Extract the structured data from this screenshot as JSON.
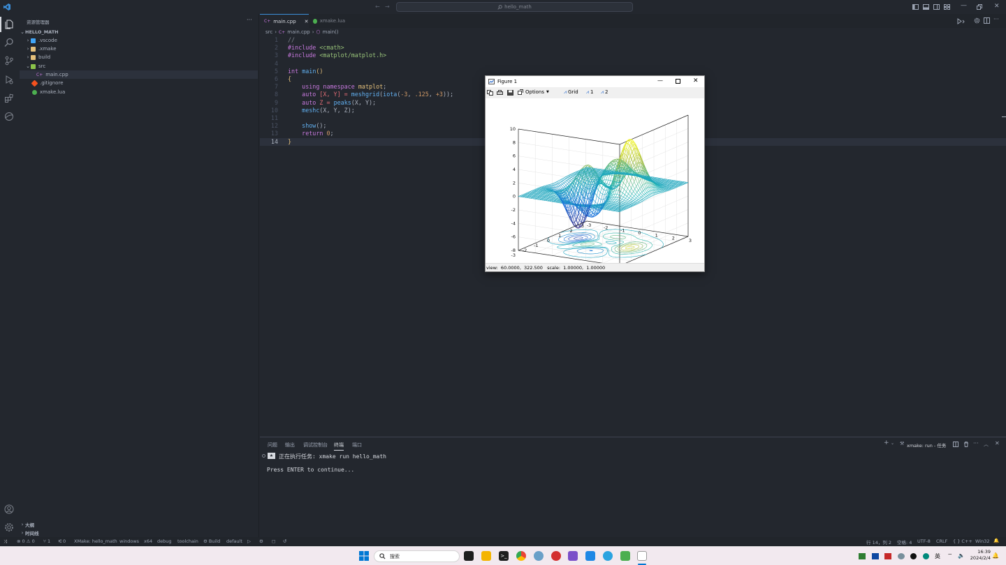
{
  "titlebar": {
    "search_text": "hello_math"
  },
  "sidebar": {
    "title": "资源管理器",
    "more": "···",
    "project": "HELLO_MATH",
    "items": [
      {
        "label": ".vscode",
        "kind": "folder",
        "color": "#42a5f5"
      },
      {
        "label": ".xmake",
        "kind": "folder",
        "color": "#e5c07b"
      },
      {
        "label": "build",
        "kind": "folder",
        "color": "#e5c07b"
      },
      {
        "label": "src",
        "kind": "folder-open",
        "color": "#8bc34a"
      },
      {
        "label": "main.cpp",
        "kind": "file",
        "color": "#c678dd"
      },
      {
        "label": ".gitignore",
        "kind": "file",
        "color": "#f4511e"
      },
      {
        "label": "xmake.lua",
        "kind": "file",
        "color": "#4caf50"
      }
    ],
    "outline": "大纲",
    "timeline": "时间线"
  },
  "tabs": [
    {
      "label": "main.cpp",
      "active": true,
      "close": "✕"
    },
    {
      "label": "xmake.lua",
      "active": false
    }
  ],
  "breadcrumb": {
    "folder": "src",
    "file": "main.cpp",
    "symbol": "main()"
  },
  "code": {
    "lines": [
      "1",
      "2",
      "3",
      "4",
      "5",
      "6",
      "7",
      "8",
      "9",
      "10",
      "11",
      "12",
      "13",
      "14"
    ],
    "l1": "//",
    "l2_kw": "#include",
    "l2_arg": "<cmath>",
    "l3_kw": "#include",
    "l3_arg": "<matplot/matplot.h>",
    "l5_type": "int",
    "l5_fn": "main",
    "l5_paren": "()",
    "l6": "{",
    "l7_kw": "using namespace",
    "l7_ns": "matplot",
    "l7_end": ";",
    "l8_kw": "auto",
    "l8_a": "[X, Y] = ",
    "l8_fn1": "meshgrid",
    "l8_b": "(",
    "l8_fn2": "iota",
    "l8_c": "(",
    "l8_n1": "-3",
    "l8_d": ", ",
    "l8_n2": ".125",
    "l8_e": ", ",
    "l8_n3": "+3",
    "l8_f": "));",
    "l9_kw": "auto",
    "l9_a": "Z = ",
    "l9_fn": "peaks",
    "l9_b": "(X, Y);",
    "l10_fn": "meshc",
    "l10_b": "(X, Y, Z);",
    "l12_fn": "show",
    "l12_b": "();",
    "l13_kw": "return",
    "l13_n": "0",
    "l13_b": ";",
    "l14": "}"
  },
  "panel": {
    "tabs": [
      "问题",
      "输出",
      "调试控制台",
      "终端",
      "端口"
    ],
    "active_tab": "终端",
    "task_label": "xmake: run - 任务",
    "task_line": "正在执行任务: xmake run hello_math",
    "prompt_line": "Press ENTER to continue..."
  },
  "statusbar": {
    "errors": "0",
    "warnings": "0",
    "sync": "1",
    "ports": "0",
    "project": "XMake: hello_math",
    "platform": "windows",
    "arch": "x64",
    "mode": "debug",
    "toolchain": "toolchain",
    "build": "Build",
    "target": "default",
    "position": "行 14，列 2",
    "spaces": "空格: 4",
    "encoding": "UTF-8",
    "eol": "CRLF",
    "language": "C++",
    "os": "Win32"
  },
  "taskbar": {
    "search_placeholder": "搜索",
    "ime": "英",
    "time": "16:39",
    "date": "2024/2/4"
  },
  "figure": {
    "title": "Figure 1",
    "toolbar": {
      "options": "Options",
      "grid": "Grid",
      "one": "1",
      "two": "2"
    },
    "status": "view:  60.0000,  322.500   scale:  1.00000,  1.00000",
    "z_ticks": [
      "10",
      "8",
      "6",
      "4",
      "2",
      "0",
      "-2",
      "-4",
      "-6",
      "-8"
    ],
    "x_ticks": [
      "3",
      "2",
      "1",
      "0",
      "-1",
      "-2",
      "-3"
    ],
    "y_ticks": [
      "-3",
      "-2",
      "-1",
      "0",
      "1",
      "2",
      "3"
    ]
  },
  "chart_data": {
    "type": "surface-mesh-with-contours",
    "function": "peaks",
    "x_range": [
      -3,
      3
    ],
    "y_range": [
      -3,
      3
    ],
    "grid_step": 0.125,
    "zlim": [
      -8,
      10
    ],
    "view": [
      60.0,
      322.5
    ],
    "colormap": "parula",
    "z_ticks": [
      10,
      8,
      6,
      4,
      2,
      0,
      -2,
      -4,
      -6,
      -8
    ],
    "x_ticks": [
      3,
      2,
      1,
      0,
      -1,
      -2,
      -3
    ],
    "y_ticks": [
      -3,
      -2,
      -1,
      0,
      1,
      2,
      3
    ],
    "grid": true
  }
}
